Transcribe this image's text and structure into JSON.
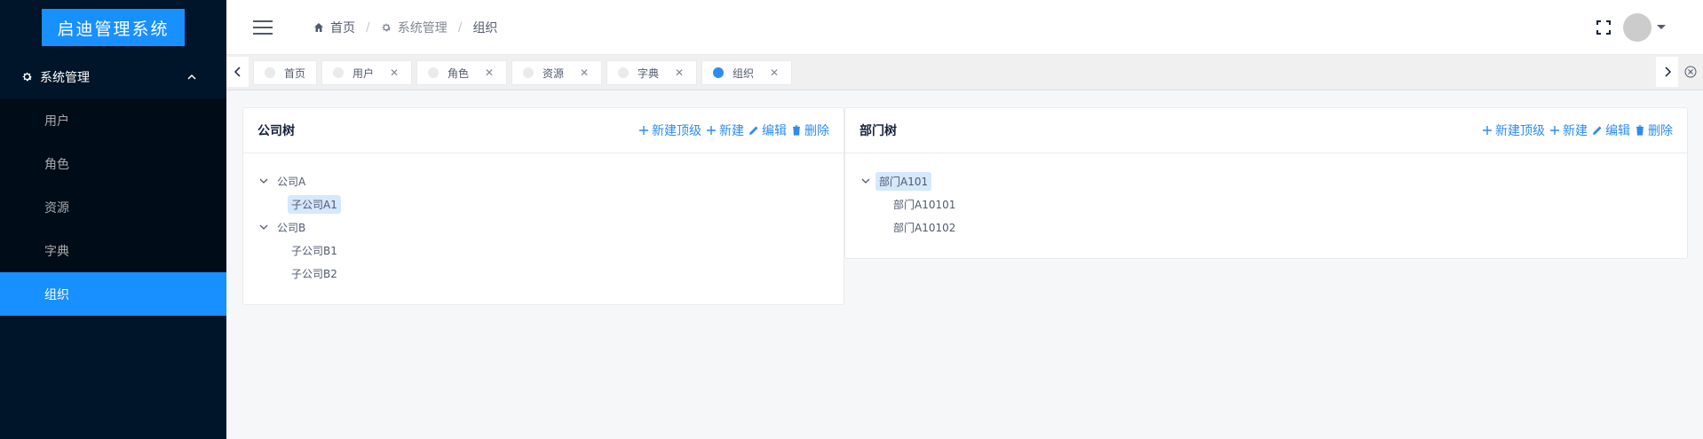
{
  "app": {
    "logo": "启迪管理系统"
  },
  "sidebar": {
    "group_label": "系统管理",
    "items": [
      {
        "label": "用户"
      },
      {
        "label": "角色"
      },
      {
        "label": "资源"
      },
      {
        "label": "字典"
      },
      {
        "label": "组织",
        "active": true
      }
    ]
  },
  "breadcrumb": {
    "home": "首页",
    "section": "系统管理",
    "current": "组织"
  },
  "tags": [
    {
      "label": "首页",
      "closable": false
    },
    {
      "label": "用户",
      "closable": true
    },
    {
      "label": "角色",
      "closable": true
    },
    {
      "label": "资源",
      "closable": true
    },
    {
      "label": "字典",
      "closable": true
    },
    {
      "label": "组织",
      "closable": true,
      "active": true
    }
  ],
  "actions": {
    "add_top": "新建顶级",
    "add": "新建",
    "edit": "编辑",
    "delete": "删除"
  },
  "company_tree": {
    "title": "公司树",
    "nodes": [
      {
        "label": "公司A",
        "children": [
          {
            "label": "子公司A1",
            "selected": true
          }
        ]
      },
      {
        "label": "公司B",
        "children": [
          {
            "label": "子公司B1"
          },
          {
            "label": "子公司B2"
          }
        ]
      }
    ]
  },
  "dept_tree": {
    "title": "部门树",
    "nodes": [
      {
        "label": "部门A101",
        "selected": true,
        "children": [
          {
            "label": "部门A10101"
          },
          {
            "label": "部门A10102"
          }
        ]
      }
    ]
  },
  "colors": {
    "accent": "#1890ff",
    "sidebar_bg": "#001529",
    "link": "#2d8cf0"
  }
}
